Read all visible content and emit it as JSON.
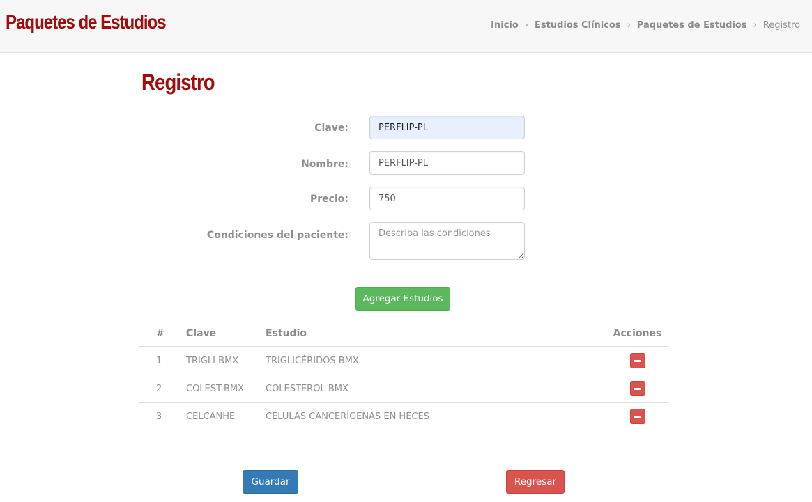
{
  "header": {
    "title": "Paquetes de Estudios",
    "breadcrumb": [
      {
        "label": "Inicio"
      },
      {
        "label": "Estudios Clínicos"
      },
      {
        "label": "Paquetes de Estudios"
      },
      {
        "label": "Registro"
      }
    ],
    "separator": "›"
  },
  "page": {
    "title": "Registro"
  },
  "form": {
    "clave": {
      "label": "Clave:",
      "value": "PERFLIP-PL"
    },
    "nombre": {
      "label": "Nombre:",
      "value": "PERFLIP-PL"
    },
    "precio": {
      "label": "Precio:",
      "value": "750"
    },
    "condiciones": {
      "label": "Condiciones del paciente:",
      "value": "",
      "placeholder": "Describa las condiciones"
    },
    "add_button": "Agregar Estudios"
  },
  "table": {
    "headers": {
      "num": "#",
      "clave": "Clave",
      "estudio": "Estudio",
      "acciones": "Acciones"
    },
    "rows": [
      {
        "num": "1",
        "clave": "TRIGLI-BMX",
        "estudio": "TRIGLICÉRIDOS BMX"
      },
      {
        "num": "2",
        "clave": "COLEST-BMX",
        "estudio": "COLESTEROL BMX"
      },
      {
        "num": "3",
        "clave": "CELCANHE",
        "estudio": "CÉLULAS CANCERÍGENAS EN HECES"
      }
    ]
  },
  "footer": {
    "save_label": "Guardar",
    "back_label": "Regresar"
  },
  "colors": {
    "brand": "#a10d0d",
    "success": "#5cb85c",
    "primary": "#337ab7",
    "danger": "#d9534f"
  },
  "icons": {
    "remove": "minus-icon"
  }
}
